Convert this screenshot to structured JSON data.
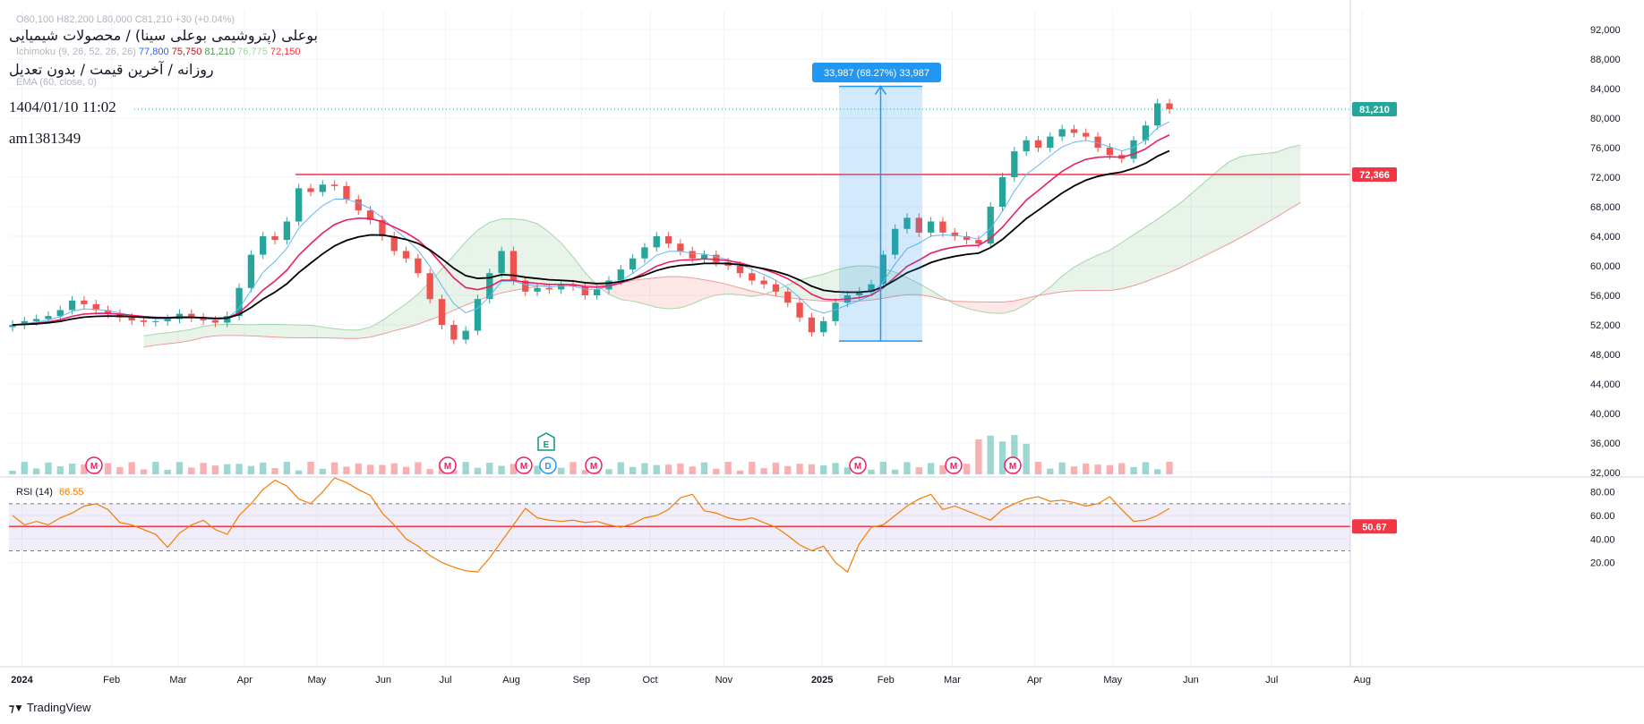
{
  "header": {
    "symbol": "بوعلی (پتروشیمی بوعلی سینا) / محصولات شیمیایی",
    "subtitle": "روزانه / آخرین قیمت / بدون تعدیل",
    "datetime": "1404/01/10 11:02",
    "author": "am1381349",
    "ohlc": "O80,100 H82,200 L80,000 C81,210 +30 (+0.04%)",
    "ichimoku_label": "Ichimoku (9, 26, 52, 26, 26)",
    "ichimoku_values": [
      "77,800",
      "75,750",
      "81,210",
      "76,775",
      "72,150"
    ],
    "ema_label": "EMA (60, close, 0)"
  },
  "footer": {
    "brand": "TradingView"
  },
  "colors": {
    "up": "#26a69a",
    "down": "#ef5350",
    "accent": "#2962ff",
    "hline": "#f23645"
  },
  "chart_data": [
    {
      "type": "candlestick",
      "price_axis": [
        "92,000",
        "88,000",
        "84,000",
        "80,000",
        "76,000",
        "72,000",
        "68,000",
        "64,000",
        "60,000",
        "56,000",
        "52,000",
        "48,000",
        "44,000",
        "40,000",
        "36,000",
        "32,000"
      ],
      "ylim": [
        32000,
        94000
      ],
      "time_axis": [
        "2024",
        "Feb",
        "Mar",
        "Apr",
        "May",
        "Jun",
        "Jul",
        "Aug",
        "Sep",
        "Oct",
        "Nov",
        "2025",
        "Feb",
        "Mar",
        "Apr",
        "May",
        "Jun",
        "Jul",
        "Aug"
      ],
      "close": [
        52000,
        52500,
        52800,
        53200,
        54000,
        55300,
        54800,
        54000,
        53500,
        53000,
        52600,
        52400,
        52500,
        52800,
        53500,
        53000,
        52600,
        52300,
        53200,
        57000,
        61500,
        64000,
        63500,
        66000,
        70500,
        70000,
        71000,
        70800,
        69000,
        67500,
        66200,
        64000,
        62000,
        61000,
        59000,
        55500,
        52000,
        50000,
        51200,
        55500,
        59000,
        62000,
        58000,
        56500,
        57000,
        56800,
        57500,
        57200,
        56000,
        56800,
        58000,
        59500,
        61000,
        62500,
        64000,
        63000,
        62000,
        61000,
        61500,
        60500,
        60000,
        59000,
        58000,
        57500,
        56500,
        55000,
        53000,
        51000,
        52500,
        55000,
        56000,
        56500,
        57500,
        61500,
        65000,
        66500,
        64500,
        66000,
        64500,
        64000,
        63500,
        63000,
        68000,
        72000,
        75500,
        77000,
        76000,
        77500,
        78500,
        78000,
        77500,
        76000,
        75000,
        74500,
        77000,
        79000,
        82000,
        81210
      ],
      "current_price": "81,210",
      "horizontal_line": "72,366",
      "measure_label": "33,987 (68.27%) 33,987",
      "events": [
        "M",
        "M",
        "M",
        "D",
        "M",
        "M",
        "M",
        "M",
        "E"
      ]
    },
    {
      "type": "line",
      "title": "RSI (14)",
      "current": "66.55",
      "axis": [
        "80.00",
        "60.00",
        "40.00",
        "20.00"
      ],
      "ylim": [
        8,
        98
      ],
      "band": [
        30,
        70
      ],
      "horizontal_line": "50.67",
      "values": [
        60,
        52,
        55,
        52,
        58,
        62,
        68,
        70,
        65,
        54,
        52,
        48,
        44,
        33,
        45,
        52,
        56,
        48,
        44,
        60,
        70,
        82,
        90,
        85,
        74,
        70,
        80,
        92,
        88,
        82,
        77,
        62,
        52,
        40,
        34,
        26,
        20,
        16,
        13,
        12,
        24,
        38,
        52,
        66,
        58,
        56,
        55,
        56,
        54,
        55,
        52,
        50,
        53,
        58,
        60,
        65,
        75,
        78,
        64,
        62,
        58,
        56,
        58,
        54,
        50,
        43,
        35,
        30,
        34,
        20,
        12,
        36,
        50,
        52,
        60,
        68,
        74,
        78,
        65,
        68,
        64,
        60,
        56,
        65,
        70,
        74,
        76,
        72,
        73,
        71,
        68,
        70,
        76,
        65,
        55,
        56,
        60,
        66
      ]
    }
  ]
}
